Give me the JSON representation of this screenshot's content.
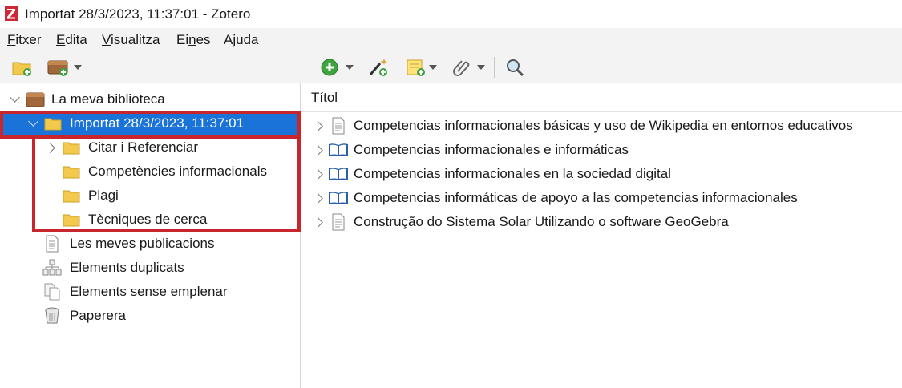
{
  "window": {
    "title": "Importat 28/3/2023, 11:37:01 - Zotero",
    "logo_letter": "Z",
    "logo_color": "#cc2936"
  },
  "menu": [
    {
      "label": "Fitxer",
      "mnemonic": "F"
    },
    {
      "label": "Edita",
      "mnemonic": "E"
    },
    {
      "label": "Visualitza",
      "mnemonic": "V"
    },
    {
      "label": "Eines",
      "mnemonic": "n"
    },
    {
      "label": "Ajuda",
      "mnemonic": "j"
    }
  ],
  "toolbar": {
    "new_collection": "new-collection-icon",
    "new_library": "new-library-icon",
    "new_item": "new-item-icon",
    "magic_wand": "add-by-identifier-icon",
    "new_note": "new-note-icon",
    "attachment": "attachment-icon",
    "search": "search-icon"
  },
  "collections": {
    "library": "La meva biblioteca",
    "selected": "Importat 28/3/2023, 11:37:01",
    "subcollections": [
      "Citar i Referenciar",
      "Competències informacionals",
      "Plagi",
      "Tècniques de cerca"
    ],
    "special": [
      "Les meves publicacions",
      "Elements duplicats",
      "Elements sense emplenar",
      "Paperera"
    ]
  },
  "items": {
    "column_title": "Títol",
    "rows": [
      {
        "title": "Competencias informacionales básicas y uso de Wikipedia en entornos educativos",
        "type": "document"
      },
      {
        "title": "Competencias informacionales e informáticas",
        "type": "book"
      },
      {
        "title": "Competencias informacionales en la sociedad digital",
        "type": "book"
      },
      {
        "title": "Competencias informáticas de apoyo a las competencias informacionales",
        "type": "book"
      },
      {
        "title": "Construção do Sistema Solar Utilizando o software GeoGebra",
        "type": "document"
      }
    ]
  },
  "colors": {
    "selection": "#1a73d9",
    "highlight_border": "#c8262c",
    "folder": "#f2c94c",
    "book": "#2a5ea8"
  }
}
